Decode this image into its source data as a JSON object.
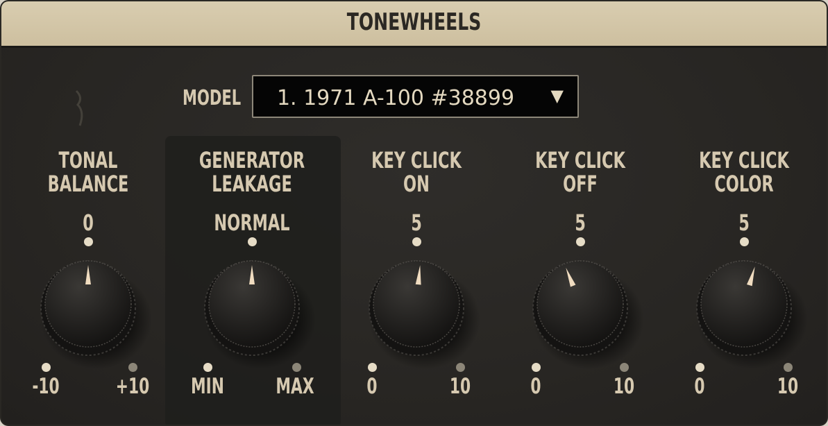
{
  "title": "TONEWHEELS",
  "model": {
    "label": "MODEL",
    "value": "1. 1971 A-100 #38899",
    "arrow": "▼"
  },
  "controls": [
    {
      "name1": "TONAL",
      "name2": "BALANCE",
      "center": "0",
      "min": "-10",
      "max": "+10",
      "value": 0.5
    },
    {
      "name1": "GENERATOR",
      "name2": "LEAKAGE",
      "center": "NORMAL",
      "min": "MIN",
      "max": "MAX",
      "value": 0.5
    },
    {
      "name1": "KEY CLICK",
      "name2": "ON",
      "center": "5",
      "min": "0",
      "max": "10",
      "value": 0.52
    },
    {
      "name1": "KEY CLICK",
      "name2": "OFF",
      "center": "5",
      "min": "0",
      "max": "10",
      "value": 0.42
    },
    {
      "name1": "KEY CLICK",
      "name2": "COLOR",
      "center": "5",
      "min": "0",
      "max": "10",
      "value": 0.56
    }
  ],
  "colors": {
    "header": "#d4c7a8",
    "panel": "#2a2825",
    "text": "#d6c9b0",
    "pointer": "#f0dcc0"
  }
}
